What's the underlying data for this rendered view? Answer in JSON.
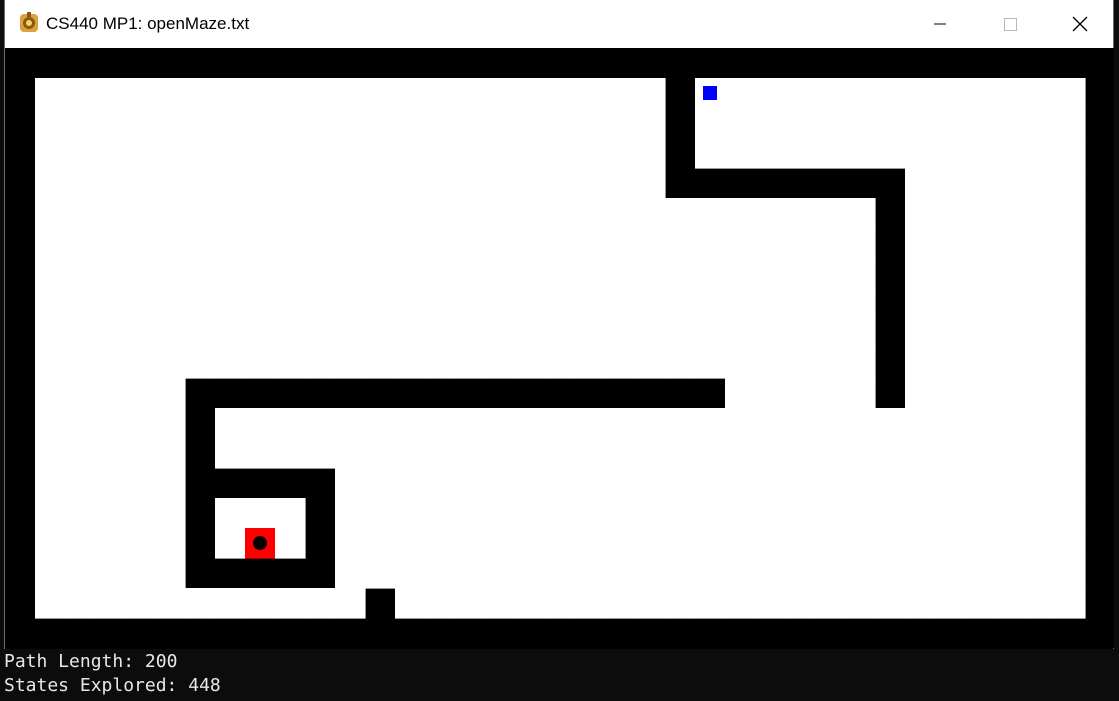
{
  "window": {
    "title": "CS440 MP1: openMaze.txt",
    "icon": "python-app-icon",
    "controls": [
      "minimize-icon",
      "maximize-icon",
      "close-icon"
    ]
  },
  "maze": {
    "file": "openMaze.txt",
    "cols": 37,
    "rows": 20,
    "colors": {
      "wall": "#000000",
      "open": "#ffffff",
      "path_start": "#ff0000",
      "path_end": "#00f500",
      "start_marker": "#0000ff",
      "goal_marker": "#000000"
    },
    "grid": [
      "#####################################",
      "#                     #             #",
      "#                     #             #",
      "#                     #             #",
      "#                     ########      #",
      "#                            #      #",
      "#                            #      #",
      "#                            #      #",
      "#                            #      #",
      "#                            #      #",
      "#                            #      #",
      "#     ##################     #      #",
      "#     #                             #",
      "#     #                             #",
      "#     #####                         #",
      "#     #   #                         #",
      "#     #   #                         #",
      "#     #####                         #",
      "#           #                       #",
      "#####################################"
    ],
    "start": [
      1,
      23
    ],
    "goal": [
      16,
      8
    ],
    "path_length": 200,
    "states_explored": 448
  },
  "status": {
    "path_length_label": "Path Length: ",
    "path_length_value": "200",
    "states_explored_label": "States Explored: ",
    "states_explored_value": "448"
  }
}
